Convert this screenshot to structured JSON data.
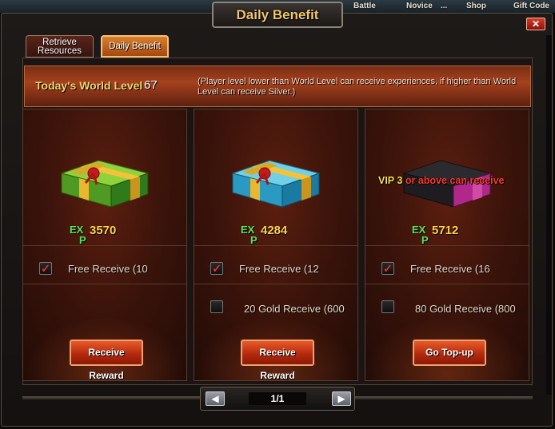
{
  "topnav": [
    "Battle",
    "Novice",
    "...",
    "Shop",
    "Gift Code"
  ],
  "window": {
    "title": "Daily Benefit",
    "close_label": "✕"
  },
  "tabs": [
    {
      "label": "Retrieve Resources",
      "active": false
    },
    {
      "label": "Daily Benefit",
      "active": true
    }
  ],
  "world_level": {
    "label": "Today's World Level",
    "value": "67",
    "note": "(Player level lower than World Level can receive experiences, if higher than World Level can receive Silver.)"
  },
  "panels": [
    {
      "gift_color": "green",
      "exp_label_top": "EX",
      "exp_label_bottom": "P",
      "exp_value": "3570",
      "options": [
        {
          "label": "Free Receive (10",
          "checked": true
        }
      ],
      "button": "Receive Reward"
    },
    {
      "gift_color": "blue",
      "exp_label_top": "EX",
      "exp_label_bottom": "P",
      "exp_value": "4284",
      "options": [
        {
          "label": "Free Receive (12",
          "checked": true
        },
        {
          "label": "20 Gold Receive (600",
          "checked": false
        }
      ],
      "button": "Receive Reward"
    },
    {
      "gift_color": "purple",
      "vip_prefix": "VIP 3",
      "vip_suffix": " or above can receive",
      "exp_label_top": "EX",
      "exp_label_bottom": "P",
      "exp_value": "5712",
      "options": [
        {
          "label": "Free Receive (16",
          "checked": true
        },
        {
          "label": "80 Gold Receive (800",
          "checked": false
        }
      ],
      "button": "Go Top-up"
    }
  ],
  "pager": {
    "prev": "◀",
    "next": "▶",
    "text": "1/1"
  },
  "colors": {
    "title_gold": "#f0c46a",
    "exp_green": "#5ce05c",
    "exp_value_gold": "#ffd24a",
    "vip_yellow": "#ffe14a",
    "vip_red": "#ff3a2a",
    "button_red": "#b52a0e"
  }
}
